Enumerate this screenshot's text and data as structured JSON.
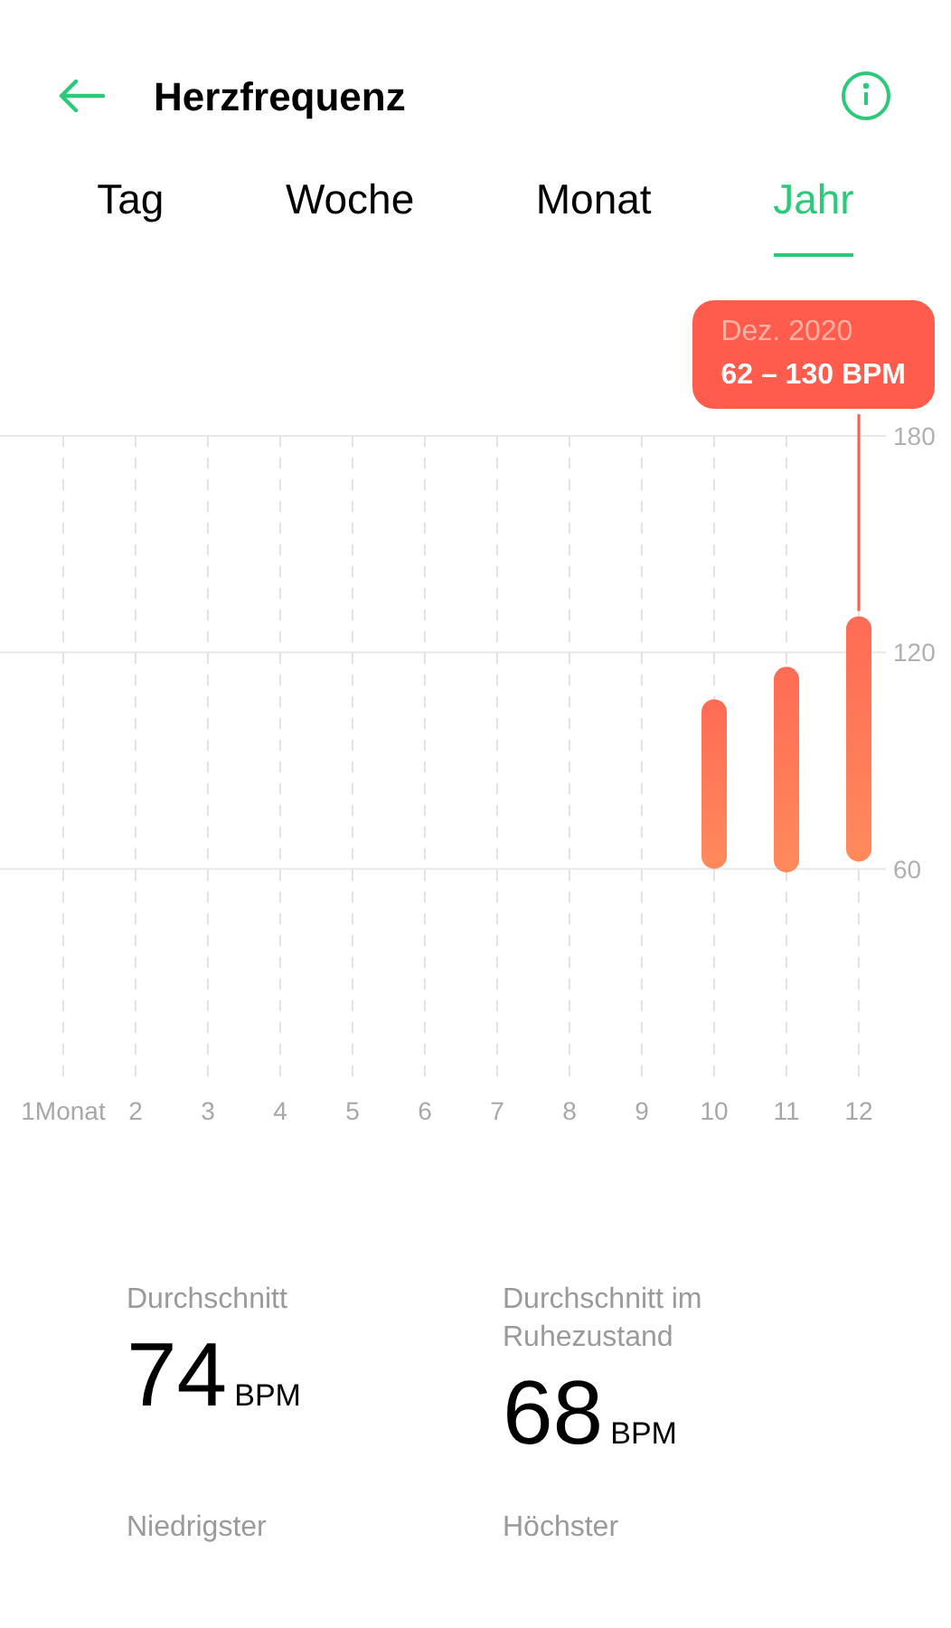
{
  "header": {
    "title": "Herzfrequenz"
  },
  "tabs": [
    {
      "label": "Tag",
      "selected": false
    },
    {
      "label": "Woche",
      "selected": false
    },
    {
      "label": "Monat",
      "selected": false
    },
    {
      "label": "Jahr",
      "selected": true
    }
  ],
  "chart": {
    "tooltip": {
      "title": "Dez. 2020",
      "range": "62 – 130 BPM"
    },
    "chart_data": {
      "type": "candlestick",
      "categories": [
        "1Monat",
        "2",
        "3",
        "4",
        "5",
        "6",
        "7",
        "8",
        "9",
        "10",
        "11",
        "12"
      ],
      "series": [
        {
          "color": "#ff6b55",
          "ohlc": [
            null,
            null,
            null,
            null,
            null,
            null,
            null,
            null,
            null,
            [
              60,
              107,
              60,
              107
            ],
            [
              59,
              116,
              59,
              116
            ],
            [
              62,
              130,
              62,
              130
            ]
          ]
        }
      ],
      "ylim": [
        0,
        180
      ],
      "yticks": [
        60,
        120,
        180
      ],
      "grid": true
    }
  },
  "stats": [
    {
      "label": "Durchschnitt",
      "value": "74",
      "unit": "BPM"
    },
    {
      "label": "Durchschnitt im Ruhezustand",
      "value": "68",
      "unit": "BPM"
    },
    {
      "label": "Niedrigster"
    },
    {
      "label": "Höchster"
    }
  ]
}
